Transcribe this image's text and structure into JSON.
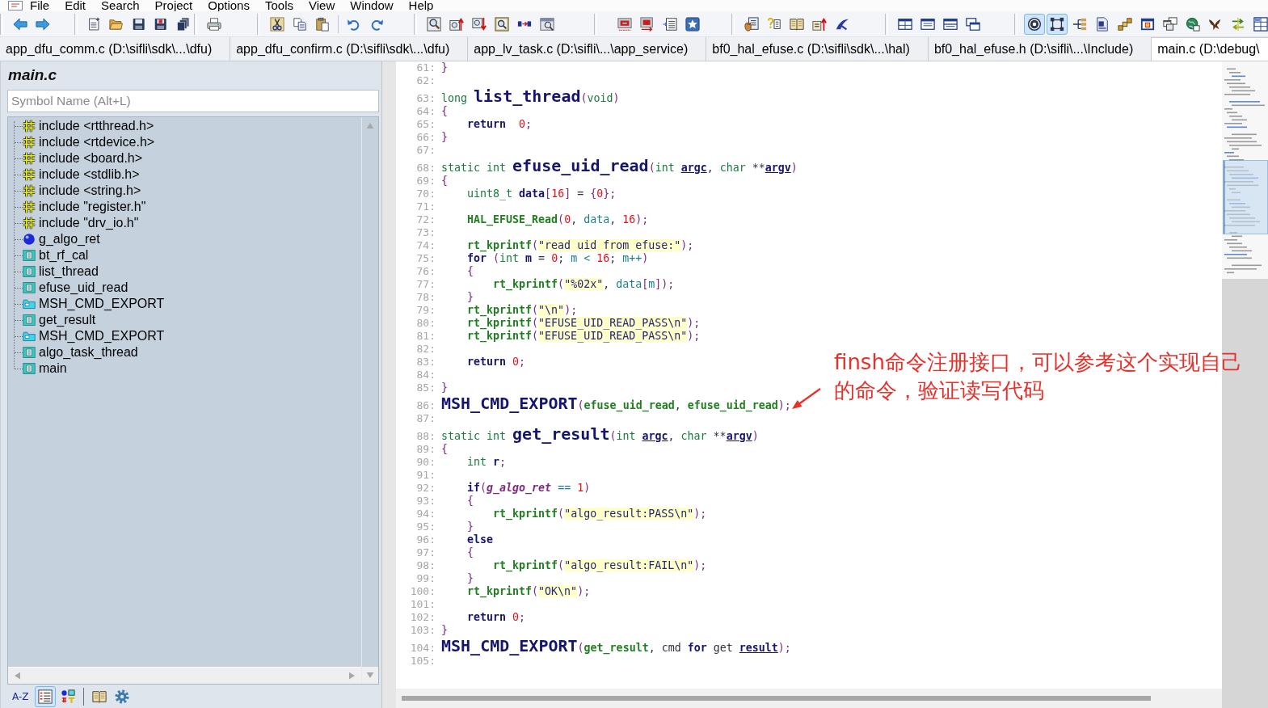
{
  "menu": [
    "File",
    "Edit",
    "Search",
    "Project",
    "Options",
    "Tools",
    "View",
    "Window",
    "Help"
  ],
  "toolbar_bands": [
    [
      [
        {
          "pressed": false
        },
        {
          "pressed": false
        }
      ]
    ],
    [
      [
        {
          "pressed": false
        },
        {
          "pressed": false
        },
        {
          "pressed": false
        },
        {
          "pressed": false
        },
        {
          "pressed": false
        }
      ]
    ],
    [
      [
        {
          "pressed": false
        }
      ]
    ],
    [
      [
        {
          "pressed": false
        },
        {
          "pressed": false
        },
        {
          "pressed": false
        }
      ],
      [
        {
          "pressed": false
        },
        {
          "pressed": false
        }
      ]
    ],
    [
      [
        {
          "pressed": false
        },
        {
          "pressed": false
        },
        {
          "pressed": false
        },
        {
          "pressed": false
        },
        {
          "pressed": false
        },
        {
          "pressed": false
        }
      ]
    ],
    [
      [
        {
          "pressed": false
        },
        {
          "pressed": false
        },
        {
          "pressed": false
        },
        {
          "pressed": false
        }
      ]
    ],
    [
      [
        {
          "pressed": false
        },
        {
          "pressed": false
        },
        {
          "pressed": false
        },
        {
          "pressed": false
        },
        {
          "pressed": false
        }
      ]
    ],
    [
      [
        {
          "pressed": false
        },
        {
          "pressed": false
        },
        {
          "pressed": false
        },
        {
          "pressed": false
        }
      ]
    ],
    [
      [
        {
          "pressed": true
        },
        {
          "pressed": true
        },
        {
          "pressed": false
        },
        {
          "pressed": false
        },
        {
          "pressed": false
        },
        {
          "pressed": false
        },
        {
          "pressed": false
        },
        {
          "pressed": false
        },
        {
          "pressed": false
        },
        {
          "pressed": false
        },
        {
          "pressed": false
        }
      ]
    ]
  ],
  "tabs": [
    {
      "label": "app_dfu_comm.c (D:\\sifli\\sdk\\...\\dfu)",
      "selected": false
    },
    {
      "label": "app_dfu_confirm.c (D:\\sifli\\sdk\\...\\dfu)",
      "selected": false
    },
    {
      "label": "app_lv_task.c (D:\\sifli\\...\\app_service)",
      "selected": false
    },
    {
      "label": "bf0_hal_efuse.c (D:\\sifli\\sdk\\...\\hal)",
      "selected": false
    },
    {
      "label": "bf0_hal_efuse.h (D:\\sifli\\...\\Include)",
      "selected": false
    },
    {
      "label": "main.c (D:\\debug\\",
      "selected": true
    }
  ],
  "symbol_panel": {
    "title": "main.c",
    "search": {
      "placeholder": "Symbol Name (Alt+L)"
    },
    "items": [
      {
        "label": "include <rtthread.h>",
        "kind": "include"
      },
      {
        "label": "include <rtdevice.h>",
        "kind": "include"
      },
      {
        "label": "include <board.h>",
        "kind": "include"
      },
      {
        "label": "include <stdlib.h>",
        "kind": "include"
      },
      {
        "label": "include <string.h>",
        "kind": "include"
      },
      {
        "label": "include \"register.h\"",
        "kind": "include"
      },
      {
        "label": "include \"drv_io.h\"",
        "kind": "include"
      },
      {
        "label": "g_algo_ret",
        "kind": "variable"
      },
      {
        "label": "bt_rf_cal",
        "kind": "function"
      },
      {
        "label": "list_thread",
        "kind": "function"
      },
      {
        "label": "efuse_uid_read",
        "kind": "function"
      },
      {
        "label": "MSH_CMD_EXPORT",
        "kind": "macro"
      },
      {
        "label": "get_result",
        "kind": "function"
      },
      {
        "label": "MSH_CMD_EXPORT",
        "kind": "macro"
      },
      {
        "label": "algo_task_thread",
        "kind": "function"
      },
      {
        "label": "main",
        "kind": "function"
      }
    ],
    "toolbar": {
      "sort_button": {
        "label": "A-Z",
        "pressed": false
      },
      "groups": [
        [
          {
            "pressed": true
          },
          {
            "pressed": false
          }
        ],
        [
          {
            "pressed": false
          },
          {
            "pressed": false
          }
        ]
      ]
    }
  },
  "editor": {
    "lines": [
      {
        "number": "61:",
        "tokens": [
          {
            "text": "}",
            "kind": "punct"
          }
        ]
      },
      {
        "number": "62:"
      },
      {
        "number": "63:",
        "tokens": [
          {
            "text": "long ",
            "kind": "type"
          },
          {
            "text": "list_thread",
            "kind": "name"
          },
          {
            "text": "(",
            "kind": "punct"
          },
          {
            "text": "void",
            "kind": "type"
          },
          {
            "text": ")",
            "kind": "punct"
          }
        ]
      },
      {
        "number": "64:",
        "tokens": [
          {
            "text": "{",
            "kind": "punct"
          }
        ]
      },
      {
        "number": "65:",
        "tokens": [
          {
            "text": "    return  ",
            "kind": "keyword"
          },
          {
            "text": "0",
            "kind": "number"
          },
          {
            "text": ";",
            "kind": "punct"
          }
        ]
      },
      {
        "number": "66:",
        "tokens": [
          {
            "text": "}",
            "kind": "punct"
          }
        ]
      },
      {
        "number": "67:"
      },
      {
        "number": "68:",
        "tokens": [
          {
            "text": "static int ",
            "kind": "type"
          },
          {
            "text": "efuse_uid_read",
            "kind": "name"
          },
          {
            "text": "(",
            "kind": "punct"
          },
          {
            "text": "int ",
            "kind": "type"
          },
          {
            "text": "argc",
            "kind": "param"
          },
          {
            "text": ", ",
            "kind": "plain"
          },
          {
            "text": "char ",
            "kind": "type"
          },
          {
            "text": "**",
            "kind": "plain"
          },
          {
            "text": "argv",
            "kind": "param"
          },
          {
            "text": ")",
            "kind": "punct"
          }
        ]
      },
      {
        "number": "69:",
        "tokens": [
          {
            "text": "{",
            "kind": "punct"
          }
        ]
      },
      {
        "number": "70:",
        "tokens": [
          {
            "text": "    uint8_t ",
            "kind": "type"
          },
          {
            "text": "data",
            "kind": "decl"
          },
          {
            "text": "[",
            "kind": "punct"
          },
          {
            "text": "16",
            "kind": "number"
          },
          {
            "text": "]",
            "kind": "punct"
          },
          {
            "text": " = ",
            "kind": "plain"
          },
          {
            "text": "{",
            "kind": "punct"
          },
          {
            "text": "0",
            "kind": "number"
          },
          {
            "text": "};",
            "kind": "punct"
          }
        ]
      },
      {
        "number": "71:"
      },
      {
        "number": "72:",
        "tokens": [
          {
            "text": "    HAL_EFUSE_Read",
            "kind": "call"
          },
          {
            "text": "(",
            "kind": "punct"
          },
          {
            "text": "0",
            "kind": "number"
          },
          {
            "text": ", ",
            "kind": "plain"
          },
          {
            "text": "data",
            "kind": "var"
          },
          {
            "text": ", ",
            "kind": "plain"
          },
          {
            "text": "16",
            "kind": "number"
          },
          {
            "text": ");",
            "kind": "punct"
          }
        ]
      },
      {
        "number": "73:"
      },
      {
        "number": "74:",
        "tokens": [
          {
            "text": "    rt_kprintf",
            "kind": "call"
          },
          {
            "text": "(",
            "kind": "punct"
          },
          {
            "text": "\"read uid from efuse:\"",
            "kind": "string"
          },
          {
            "text": ");",
            "kind": "punct"
          }
        ]
      },
      {
        "number": "75:",
        "tokens": [
          {
            "text": "    for ",
            "kind": "keyword"
          },
          {
            "text": "(",
            "kind": "punct"
          },
          {
            "text": "int ",
            "kind": "type"
          },
          {
            "text": "m",
            "kind": "decl"
          },
          {
            "text": " = ",
            "kind": "plain"
          },
          {
            "text": "0",
            "kind": "number"
          },
          {
            "text": "; ",
            "kind": "plain"
          },
          {
            "text": "m",
            "kind": "var"
          },
          {
            "text": " < ",
            "kind": "var"
          },
          {
            "text": "16",
            "kind": "number"
          },
          {
            "text": "; ",
            "kind": "plain"
          },
          {
            "text": "m++",
            "kind": "var"
          },
          {
            "text": ")",
            "kind": "punct"
          }
        ]
      },
      {
        "number": "76:",
        "tokens": [
          {
            "text": "    {",
            "kind": "punct"
          }
        ]
      },
      {
        "number": "77:",
        "tokens": [
          {
            "text": "        rt_kprintf",
            "kind": "call"
          },
          {
            "text": "(",
            "kind": "punct"
          },
          {
            "text": "\"%02x\"",
            "kind": "string"
          },
          {
            "text": ", ",
            "kind": "plain"
          },
          {
            "text": "data",
            "kind": "var"
          },
          {
            "text": "[",
            "kind": "punct"
          },
          {
            "text": "m",
            "kind": "var"
          },
          {
            "text": "]);",
            "kind": "punct"
          }
        ]
      },
      {
        "number": "78:",
        "tokens": [
          {
            "text": "    }",
            "kind": "punct"
          }
        ]
      },
      {
        "number": "79:",
        "tokens": [
          {
            "text": "    rt_kprintf",
            "kind": "call"
          },
          {
            "text": "(",
            "kind": "punct"
          },
          {
            "text": "\"\\n\"",
            "kind": "string"
          },
          {
            "text": ");",
            "kind": "punct"
          }
        ]
      },
      {
        "number": "80:",
        "tokens": [
          {
            "text": "    rt_kprintf",
            "kind": "call"
          },
          {
            "text": "(",
            "kind": "punct"
          },
          {
            "text": "\"EFUSE_UID_READ_PASS\\n\"",
            "kind": "string"
          },
          {
            "text": ");",
            "kind": "punct"
          }
        ]
      },
      {
        "number": "81:",
        "tokens": [
          {
            "text": "    rt_kprintf",
            "kind": "call"
          },
          {
            "text": "(",
            "kind": "punct"
          },
          {
            "text": "\"EFUSE_UID_READ_PASS\\n\"",
            "kind": "string"
          },
          {
            "text": ");",
            "kind": "punct"
          }
        ]
      },
      {
        "number": "82:"
      },
      {
        "number": "83:",
        "tokens": [
          {
            "text": "    return ",
            "kind": "keyword"
          },
          {
            "text": "0",
            "kind": "number"
          },
          {
            "text": ";",
            "kind": "punct"
          }
        ]
      },
      {
        "number": "84:"
      },
      {
        "number": "85:",
        "tokens": [
          {
            "text": "}",
            "kind": "punct"
          }
        ]
      },
      {
        "number": "86:",
        "tokens": [
          {
            "text": "MSH_CMD_EXPORT",
            "kind": "macro"
          },
          {
            "text": "(",
            "kind": "punct"
          },
          {
            "text": "efuse_uid_read",
            "kind": "arg"
          },
          {
            "text": ", ",
            "kind": "plain"
          },
          {
            "text": "efuse_uid_read",
            "kind": "arg"
          },
          {
            "text": ");",
            "kind": "punct"
          }
        ]
      },
      {
        "number": "87:"
      },
      {
        "number": "88:",
        "tokens": [
          {
            "text": "static int ",
            "kind": "type"
          },
          {
            "text": "get_result",
            "kind": "name"
          },
          {
            "text": "(",
            "kind": "punct"
          },
          {
            "text": "int ",
            "kind": "type"
          },
          {
            "text": "argc",
            "kind": "param"
          },
          {
            "text": ", ",
            "kind": "plain"
          },
          {
            "text": "char ",
            "kind": "type"
          },
          {
            "text": "**",
            "kind": "plain"
          },
          {
            "text": "argv",
            "kind": "param"
          },
          {
            "text": ")",
            "kind": "punct"
          }
        ]
      },
      {
        "number": "89:",
        "tokens": [
          {
            "text": "{",
            "kind": "punct"
          }
        ]
      },
      {
        "number": "90:",
        "tokens": [
          {
            "text": "    int ",
            "kind": "type"
          },
          {
            "text": "r",
            "kind": "decl"
          },
          {
            "text": ";",
            "kind": "punct"
          }
        ]
      },
      {
        "number": "91:"
      },
      {
        "number": "92:",
        "tokens": [
          {
            "text": "    if",
            "kind": "keyword"
          },
          {
            "text": "(",
            "kind": "punct"
          },
          {
            "text": "g_algo_ret",
            "kind": "global"
          },
          {
            "text": " == ",
            "kind": "var"
          },
          {
            "text": "1",
            "kind": "number"
          },
          {
            "text": ")",
            "kind": "punct"
          }
        ]
      },
      {
        "number": "93:",
        "tokens": [
          {
            "text": "    {",
            "kind": "punct"
          }
        ]
      },
      {
        "number": "94:",
        "tokens": [
          {
            "text": "        rt_kprintf",
            "kind": "call"
          },
          {
            "text": "(",
            "kind": "punct"
          },
          {
            "text": "\"algo_result:PASS\\n\"",
            "kind": "string"
          },
          {
            "text": ");",
            "kind": "punct"
          }
        ]
      },
      {
        "number": "95:",
        "tokens": [
          {
            "text": "    }",
            "kind": "punct"
          }
        ]
      },
      {
        "number": "96:",
        "tokens": [
          {
            "text": "    else",
            "kind": "keyword"
          }
        ]
      },
      {
        "number": "97:",
        "tokens": [
          {
            "text": "    {",
            "kind": "punct"
          }
        ]
      },
      {
        "number": "98:",
        "tokens": [
          {
            "text": "        rt_kprintf",
            "kind": "call"
          },
          {
            "text": "(",
            "kind": "punct"
          },
          {
            "text": "\"algo_result:FAIL\\n\"",
            "kind": "string"
          },
          {
            "text": ");",
            "kind": "punct"
          }
        ]
      },
      {
        "number": "99:",
        "tokens": [
          {
            "text": "    }",
            "kind": "punct"
          }
        ]
      },
      {
        "number": "100:",
        "tokens": [
          {
            "text": "    rt_kprintf",
            "kind": "call"
          },
          {
            "text": "(",
            "kind": "punct"
          },
          {
            "text": "\"OK\\n\"",
            "kind": "string"
          },
          {
            "text": ");",
            "kind": "punct"
          }
        ]
      },
      {
        "number": "101:"
      },
      {
        "number": "102:",
        "tokens": [
          {
            "text": "    return ",
            "kind": "keyword"
          },
          {
            "text": "0",
            "kind": "number"
          },
          {
            "text": ";",
            "kind": "punct"
          }
        ]
      },
      {
        "number": "103:",
        "tokens": [
          {
            "text": "}",
            "kind": "punct"
          }
        ]
      },
      {
        "number": "104:",
        "tokens": [
          {
            "text": "MSH_CMD_EXPORT",
            "kind": "macro"
          },
          {
            "text": "(",
            "kind": "punct"
          },
          {
            "text": "get_result",
            "kind": "arg"
          },
          {
            "text": ", cmd ",
            "kind": "plain"
          },
          {
            "text": "for",
            "kind": "keyword"
          },
          {
            "text": " get ",
            "kind": "plain"
          },
          {
            "text": "result",
            "kind": "param"
          },
          {
            "text": ");",
            "kind": "punct"
          }
        ]
      },
      {
        "number": "105:"
      }
    ]
  },
  "annotation": {
    "text": "finsh命令注册接口，可以参考这个实现自己的命令，验证读写代码"
  }
}
